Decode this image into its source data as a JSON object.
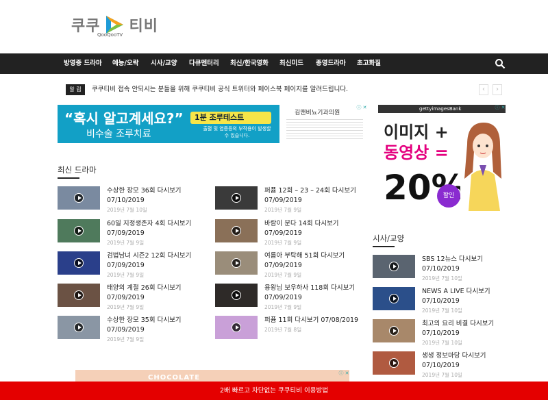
{
  "brand": {
    "logo_text_left": "쿠쿠",
    "logo_text_right": "티비",
    "logo_sub": "QooQooTV",
    "accent": "#e40000",
    "logo_play_colors": [
      "#f7a21b",
      "#7ec242",
      "#1e9bd7"
    ]
  },
  "nav": {
    "items": [
      "방영중 드라마",
      "예능/오락",
      "시사/교양",
      "다큐멘터리",
      "최신/한국영화",
      "최신미드",
      "종영드라마",
      "초고화질"
    ],
    "search_icon": "search-icon"
  },
  "alert": {
    "badge": "알 림",
    "text": "쿠쿠티비 접속 안되시는 분들을 위해 쿠쿠티비 공식 트위터와 페이스북 페이지를 알려드립니다.",
    "prev_icon": "chevron-left-icon",
    "next_icon": "chevron-right-icon"
  },
  "ad_top": {
    "headline": "“혹시 알고계세요?”",
    "sub": "비수술 조루치료",
    "badge": "1분 조루테스트",
    "note": "출혈 및 염증등의 부작용이 발생할 수 있습니다.",
    "clinic": "김맨비뇨기과의원",
    "adchoice": "ⓘ ✕"
  },
  "ad_side": {
    "topbar": "gettyimagesBank",
    "line1": "이미지 +",
    "line2": "동영상 =",
    "big": "20%",
    "sale": "할인",
    "adchoice": "ⓘ ✕"
  },
  "latest_drama": {
    "title": "최신 드라마",
    "items": [
      {
        "title": "수상한 장모 36회 다시보기",
        "date": "07/10/2019",
        "meta": "2019년 7월 10일",
        "thumb": "#7a8aa0"
      },
      {
        "title": "퍼퓸 12회 – 23 – 24회 다시보기",
        "date": "07/09/2019",
        "meta": "2019년 7월 9일",
        "thumb": "#3a3a3a"
      },
      {
        "title": "60일 지정생존자 4회 다시보기",
        "date": "07/09/2019",
        "meta": "2019년 7월 9일",
        "thumb": "#4f7a5c"
      },
      {
        "title": "바람이 분다 14회 다시보기",
        "date": "07/09/2019",
        "meta": "2019년 7월 9일",
        "thumb": "#8a7058"
      },
      {
        "title": "검법남녀 시즌2 12회 다시보기",
        "date": "07/09/2019",
        "meta": "2019년 7월 9일",
        "thumb": "#2a3f8a"
      },
      {
        "title": "여름아 부탁해 51회 다시보기",
        "date": "07/09/2019",
        "meta": "2019년 7월 9일",
        "thumb": "#9a8d7a"
      },
      {
        "title": "태양의 계절 26회 다시보기",
        "date": "07/09/2019",
        "meta": "2019년 7월 9일",
        "thumb": "#6b5244"
      },
      {
        "title": "용왕님 보우하사 118회 다시보기",
        "date": "07/09/2019",
        "meta": "2019년 7월 9일",
        "thumb": "#2e2a28"
      },
      {
        "title": "수상한 장모 35회 다시보기",
        "date": "07/09/2019",
        "meta": "2019년 7월 9일",
        "thumb": "#8a96a4"
      },
      {
        "title": "퍼퓸 11회 다시보기 07/08/2019",
        "date": "",
        "meta": "2019년 7월 8일",
        "thumb": "#c9a0d8"
      }
    ]
  },
  "current_affairs": {
    "title": "시사/교양",
    "items": [
      {
        "title": "SBS 12뉴스 다시보기",
        "date": "07/10/2019",
        "meta": "2019년 7월 10일",
        "thumb": "#5a6470"
      },
      {
        "title": "NEWS A LIVE 다시보기",
        "date": "07/10/2019",
        "meta": "2019년 7월 10일",
        "thumb": "#2b4f8a"
      },
      {
        "title": "최고의 요리 비결 다시보기",
        "date": "07/10/2019",
        "meta": "2019년 7월 10일",
        "thumb": "#a8886a"
      },
      {
        "title": "생생 정보마당 다시보기",
        "date": "07/10/2019",
        "meta": "2019년 7월 10일",
        "thumb": "#b05a40"
      }
    ]
  },
  "ad_bottom": {
    "text": "CHOCOLATE",
    "adchoice": "ⓘ ✕"
  },
  "bottom_bar": {
    "text": "2배 빠르고 차단없는 쿠쿠티비 이용방법"
  }
}
